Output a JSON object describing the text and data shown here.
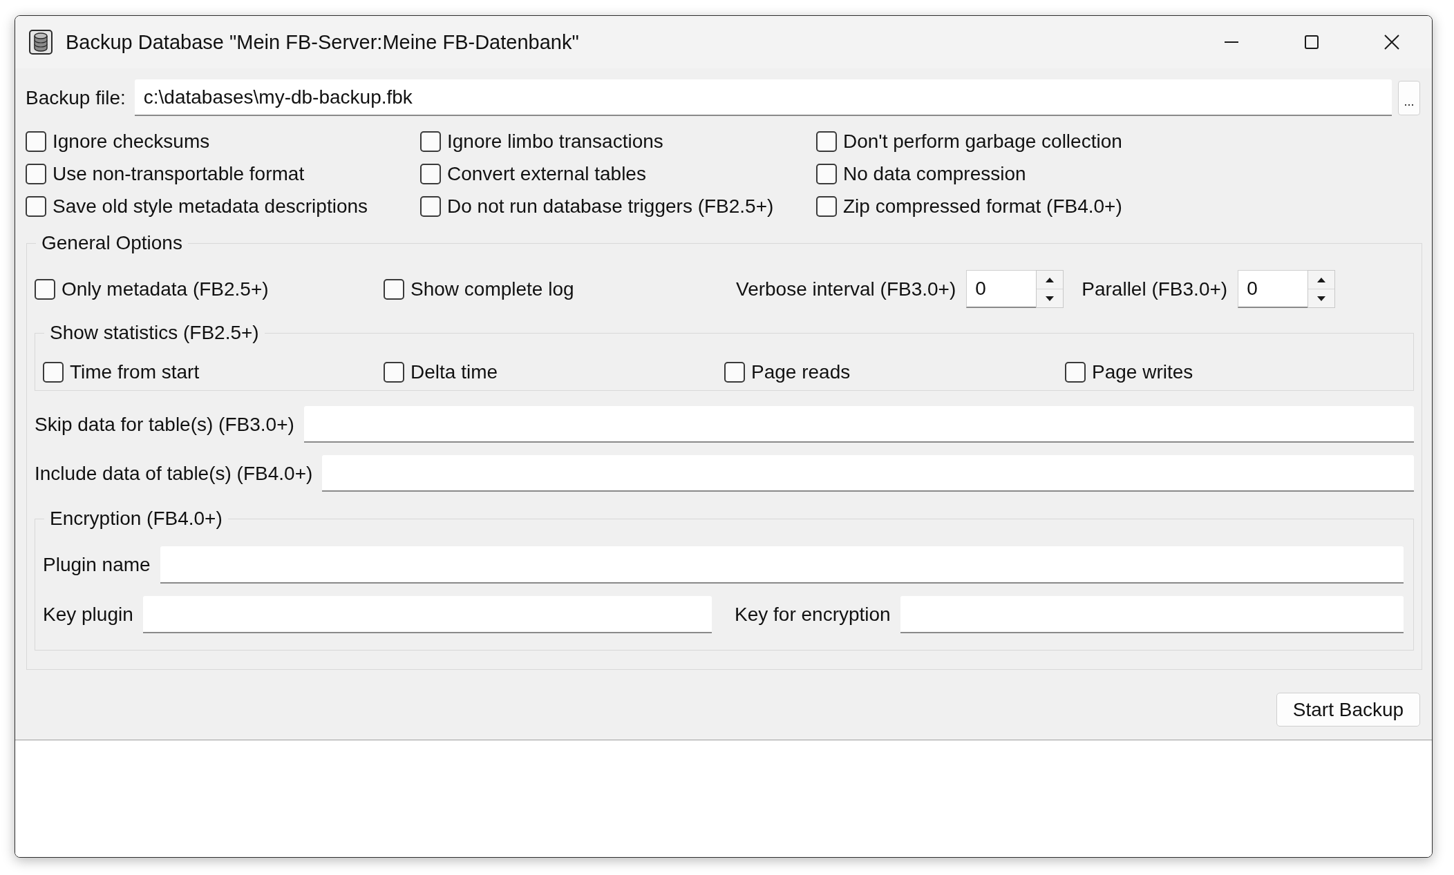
{
  "window": {
    "title": "Backup Database \"Mein FB-Server:Meine FB-Datenbank\""
  },
  "backup_file": {
    "label": "Backup file:",
    "value": "c:\\databases\\my-db-backup.fbk",
    "browse_button": "..."
  },
  "options": [
    {
      "label": "Ignore checksums",
      "checked": false
    },
    {
      "label": "Ignore limbo transactions",
      "checked": false
    },
    {
      "label": "Don't perform garbage collection",
      "checked": false
    },
    {
      "label": "Use non-transportable format",
      "checked": false
    },
    {
      "label": "Convert external tables",
      "checked": false
    },
    {
      "label": "No data compression",
      "checked": false
    },
    {
      "label": "Save old style metadata descriptions",
      "checked": false
    },
    {
      "label": "Do not run database triggers (FB2.5+)",
      "checked": false
    },
    {
      "label": "Zip compressed format (FB4.0+)",
      "checked": false
    }
  ],
  "general_options": {
    "title": "General Options",
    "checkboxes": [
      {
        "label": "Only metadata (FB2.5+)",
        "checked": false
      },
      {
        "label": "Show complete log",
        "checked": false
      }
    ],
    "spinners": [
      {
        "label": "Verbose interval (FB3.0+)",
        "value": "0"
      },
      {
        "label": "Parallel (FB3.0+)",
        "value": "0"
      }
    ],
    "statistics": {
      "title": "Show statistics (FB2.5+)",
      "checkboxes": [
        {
          "label": "Time from start",
          "checked": false
        },
        {
          "label": "Delta time",
          "checked": false
        },
        {
          "label": "Page reads",
          "checked": false
        },
        {
          "label": "Page writes",
          "checked": false
        }
      ]
    },
    "fields": [
      {
        "label": "Skip data for table(s) (FB3.0+)"
      },
      {
        "label": "Include data of table(s) (FB4.0+)"
      }
    ],
    "encryption": {
      "title": "Encryption (FB4.0+)",
      "plugin_name": {
        "label": "Plugin name"
      },
      "key_plugin": {
        "label": "Key plugin"
      },
      "key_for_encryption": {
        "label": "Key for encryption"
      }
    }
  },
  "start_button": "Start Backup"
}
